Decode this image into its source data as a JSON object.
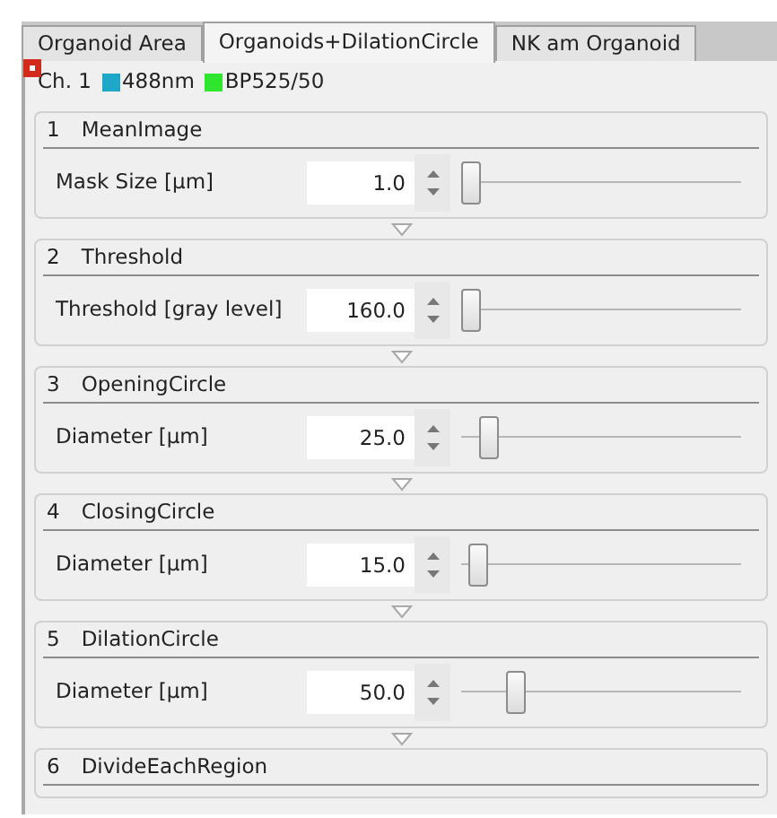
{
  "tabs": [
    {
      "label": "Organoid Area",
      "selected": false
    },
    {
      "label": "Organoids+DilationCircle",
      "selected": true
    },
    {
      "label": "NK am Organoid",
      "selected": false
    }
  ],
  "channel": {
    "label": "Ch. 1",
    "swatches": [
      {
        "label": "488nm",
        "color": "#1ea7c8"
      },
      {
        "label": "BP525/50",
        "color": "#2ee62e"
      }
    ]
  },
  "steps": [
    {
      "number": "1",
      "title": "MeanImage",
      "parameter": {
        "label": "Mask Size [µm]",
        "value": "1.0",
        "level": 0
      }
    },
    {
      "number": "2",
      "title": "Threshold",
      "parameter": {
        "label": "Threshold [gray level]",
        "value": "160.0",
        "level": 0
      }
    },
    {
      "number": "3",
      "title": "OpeningCircle",
      "parameter": {
        "label": "Diameter [µm]",
        "value": "25.0",
        "level": 0.07
      }
    },
    {
      "number": "4",
      "title": "ClosingCircle",
      "parameter": {
        "label": "Diameter [µm]",
        "value": "15.0",
        "level": 0.03
      }
    },
    {
      "number": "5",
      "title": "DilationCircle",
      "parameter": {
        "label": "Diameter [µm]",
        "value": "50.0",
        "level": 0.17
      }
    },
    {
      "number": "6",
      "title": "DivideEachRegion"
    }
  ]
}
